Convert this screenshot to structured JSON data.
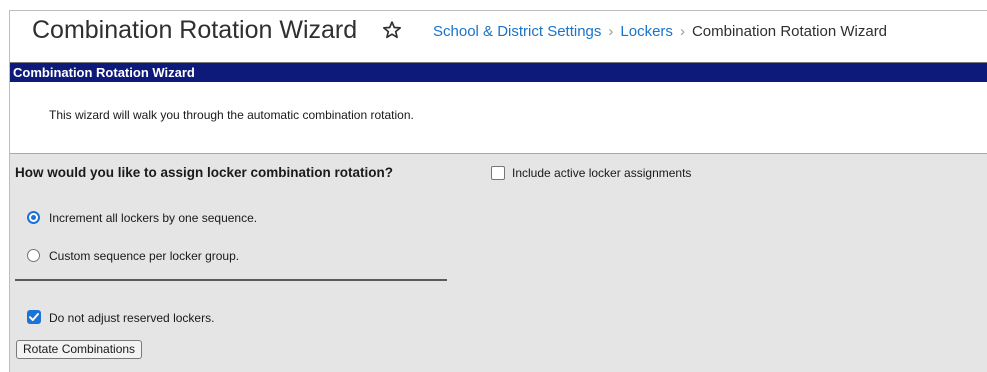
{
  "page": {
    "title": "Combination Rotation Wizard",
    "favorite_icon": "star-icon"
  },
  "breadcrumb": {
    "items": [
      "School & District Settings",
      "Lockers",
      "Combination Rotation Wizard"
    ]
  },
  "wizard": {
    "header": "Combination Rotation Wizard",
    "intro": "This wizard will walk you through the automatic combination rotation.",
    "question": "How would you like to assign locker combination rotation?",
    "include_active_label": "Include active locker assignments",
    "include_active_checked": false,
    "options": [
      {
        "label": "Increment all lockers by one sequence.",
        "selected": true
      },
      {
        "label": "Custom sequence per locker group.",
        "selected": false
      }
    ],
    "reserved_label": "Do not adjust reserved lockers.",
    "reserved_checked": true,
    "rotate_button": "Rotate Combinations"
  },
  "colors": {
    "header_bar": "#0e1a7a",
    "link": "#1a74c9",
    "accent": "#1a73d9",
    "panel_bg": "#e5e5e5"
  }
}
